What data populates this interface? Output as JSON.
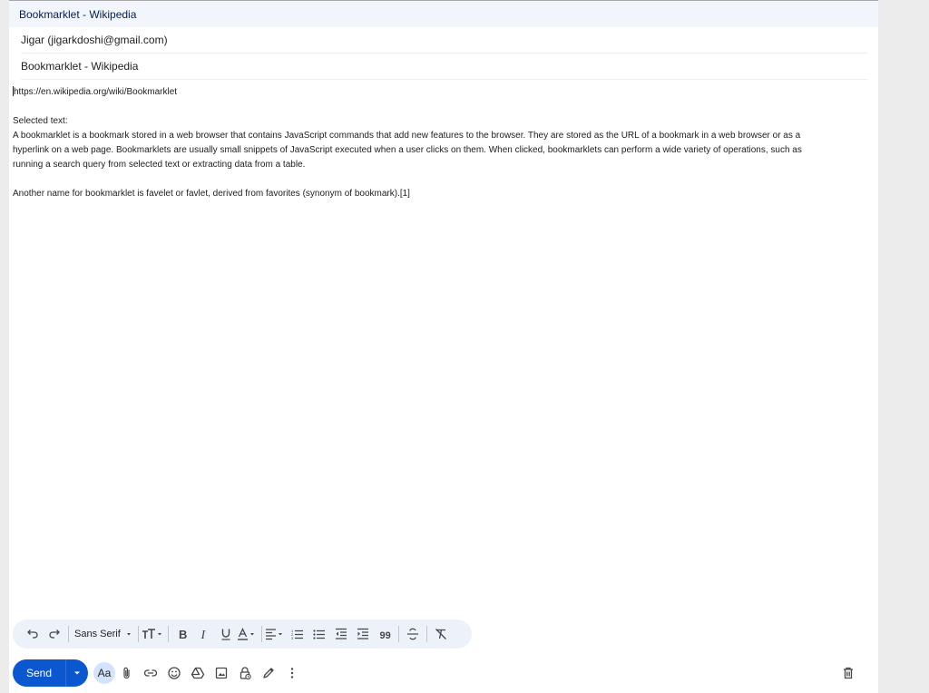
{
  "compose": {
    "title": "Bookmarklet - Wikipedia",
    "to": "Jigar (jigarkdoshi@gmail.com)",
    "subject": "Bookmarklet - Wikipedia"
  },
  "body": {
    "url": "https://en.wikipedia.org/wiki/Bookmarklet",
    "selected_label": "Selected text:",
    "paragraph1_lines": [
      "A bookmarklet is a bookmark stored in a web browser that contains JavaScript commands that add new features to the browser. They are stored as the URL of a bookmark in a web browser or as a",
      "hyperlink on a web page. Bookmarklets are usually small snippets of JavaScript executed when a user clicks on them. When clicked, bookmarklets can perform a wide variety of operations, such as",
      "running a search query from selected text or extracting data from a table."
    ],
    "paragraph2": "Another name for bookmarklet is favelet or favlet, derived from favorites (synonym of bookmark).[1]"
  },
  "format_toolbar": {
    "font": "Sans Serif",
    "icons": [
      "undo-icon",
      "redo-icon",
      "font-dropdown",
      "text-size-icon",
      "bold-icon",
      "italic-icon",
      "underline-icon",
      "text-color-icon",
      "align-icon",
      "numbered-list-icon",
      "bulleted-list-icon",
      "indent-less-icon",
      "indent-more-icon",
      "quote-icon",
      "strikethrough-icon",
      "remove-formatting-icon"
    ]
  },
  "bottom_toolbar": {
    "send_label": "Send",
    "formatting_label": "Aa",
    "icons": [
      "attach-icon",
      "link-icon",
      "emoji-icon",
      "drive-icon",
      "photo-icon",
      "confidential-icon",
      "signature-icon",
      "more-options-icon",
      "discard-icon"
    ]
  },
  "colors": {
    "send": "#0b57d0",
    "header_bg": "#f2f6fc",
    "toolbar_bg": "#edf2fa"
  }
}
